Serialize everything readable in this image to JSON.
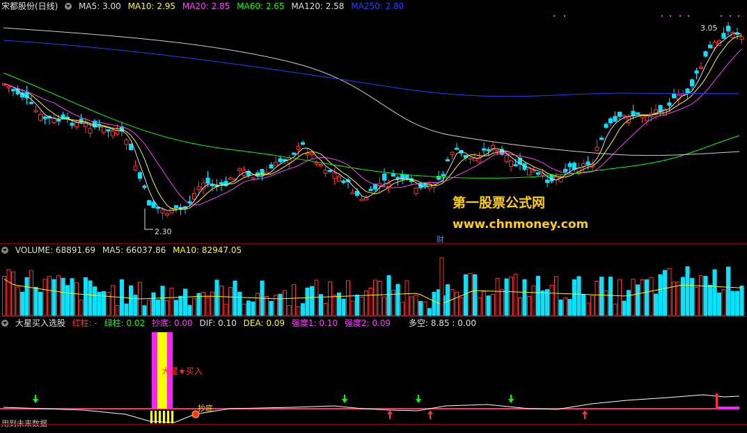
{
  "price": {
    "stock_name": "宋都股份(日线)",
    "ma_labels": [
      {
        "text": "MA5: 3.00",
        "color": "#e0e0e0"
      },
      {
        "text": "MA10: 2.95",
        "color": "#ffff00"
      },
      {
        "text": "MA20: 2.85",
        "color": "#ff40ff"
      },
      {
        "text": "MA60: 2.65",
        "color": "#00ff00"
      },
      {
        "text": "MA120: 2.58",
        "color": "#e0e0e0"
      },
      {
        "text": "MA250: 2.80",
        "color": "#2040ff"
      }
    ],
    "high_label": "3.05",
    "low_label": "2.30",
    "cai_marker": "财",
    "watermark_name": "第一股票公式网",
    "watermark_url": "www.chnmoney.com"
  },
  "volume": {
    "labels": [
      {
        "text": "VOLUME: 68891.69",
        "color": "#e0e0e0"
      },
      {
        "text": "MA5: 66037.86",
        "color": "#e0e0e0"
      },
      {
        "text": "MA10: 82947.05",
        "color": "#ffff00"
      }
    ]
  },
  "indicator": {
    "labels": [
      {
        "text": "大星买入选股",
        "color": "#e0e0e0"
      },
      {
        "text": "红柱: -",
        "color": "#ff3030"
      },
      {
        "text": "绿柱: 0.02",
        "color": "#00ff00"
      },
      {
        "text": "抄底: 0.00",
        "color": "#ff40ff"
      },
      {
        "text": "DIF: 0.10",
        "color": "#e0e0e0"
      },
      {
        "text": "DEA: 0.09",
        "color": "#ffff00"
      },
      {
        "text": "强度1: 0.10",
        "color": "#ff40ff"
      },
      {
        "text": "强度2: 0.09",
        "color": "#ff40ff"
      },
      {
        "text": "多空: 8.85 : 0.00",
        "color": "#e0e0e0"
      }
    ],
    "buy_label": "大星★买入",
    "bottom_label": "抄底",
    "future_data": "用到未来数据"
  },
  "colors": {
    "up": "#ff3030",
    "down": "#00e5ff",
    "ma5": "#e0e0e0",
    "ma10": "#ffff00",
    "ma20": "#ff40ff",
    "ma60": "#00ff00",
    "ma120": "#d0d0d0",
    "ma250": "#2040ff"
  }
}
